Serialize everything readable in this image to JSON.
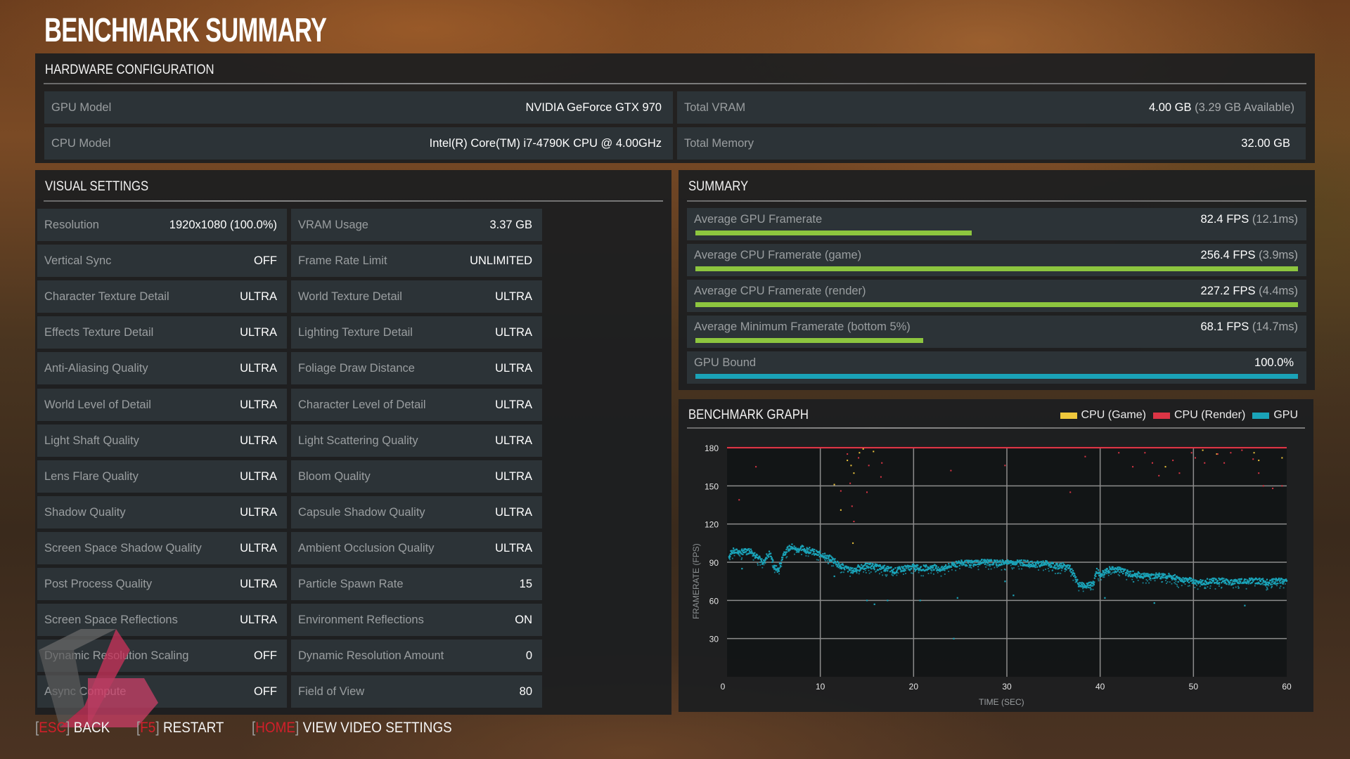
{
  "page": {
    "title": "BENCHMARK SUMMARY"
  },
  "hardware": {
    "title": "HARDWARE CONFIGURATION",
    "left": [
      {
        "label": "GPU Model",
        "value": "NVIDIA GeForce GTX 970",
        "sub": ""
      },
      {
        "label": "CPU Model",
        "value": "Intel(R) Core(TM) i7-4790K CPU @ 4.00GHz",
        "sub": ""
      }
    ],
    "right": [
      {
        "label": "Total VRAM",
        "value": "4.00 GB",
        "sub": "(3.29 GB Available)"
      },
      {
        "label": "Total Memory",
        "value": "32.00 GB",
        "sub": ""
      }
    ]
  },
  "visual_settings": {
    "title": "VISUAL SETTINGS",
    "left": [
      {
        "label": "Resolution",
        "value": "1920x1080 (100.0%)"
      },
      {
        "label": "Vertical Sync",
        "value": "OFF"
      },
      {
        "label": "Character Texture Detail",
        "value": "ULTRA"
      },
      {
        "label": "Effects Texture Detail",
        "value": "ULTRA"
      },
      {
        "label": "Anti-Aliasing Quality",
        "value": "ULTRA"
      },
      {
        "label": "World Level of Detail",
        "value": "ULTRA"
      },
      {
        "label": "Light Shaft Quality",
        "value": "ULTRA"
      },
      {
        "label": "Lens Flare Quality",
        "value": "ULTRA"
      },
      {
        "label": "Shadow Quality",
        "value": "ULTRA"
      },
      {
        "label": "Screen Space Shadow Quality",
        "value": "ULTRA"
      },
      {
        "label": "Post Process Quality",
        "value": "ULTRA"
      },
      {
        "label": "Screen Space Reflections",
        "value": "ULTRA"
      },
      {
        "label": "Dynamic Resolution Scaling",
        "value": "OFF"
      },
      {
        "label": "Async Compute",
        "value": "OFF"
      }
    ],
    "right": [
      {
        "label": "VRAM Usage",
        "value": "3.37 GB"
      },
      {
        "label": "Frame Rate Limit",
        "value": "UNLIMITED"
      },
      {
        "label": "World Texture Detail",
        "value": "ULTRA"
      },
      {
        "label": "Lighting Texture Detail",
        "value": "ULTRA"
      },
      {
        "label": "Foliage Draw Distance",
        "value": "ULTRA"
      },
      {
        "label": "Character Level of Detail",
        "value": "ULTRA"
      },
      {
        "label": "Light Scattering Quality",
        "value": "ULTRA"
      },
      {
        "label": "Bloom Quality",
        "value": "ULTRA"
      },
      {
        "label": "Capsule Shadow Quality",
        "value": "ULTRA"
      },
      {
        "label": "Ambient Occlusion Quality",
        "value": "ULTRA"
      },
      {
        "label": "Particle Spawn Rate",
        "value": "15"
      },
      {
        "label": "Environment Reflections",
        "value": "ON"
      },
      {
        "label": "Dynamic Resolution Amount",
        "value": "0"
      },
      {
        "label": "Field of View",
        "value": "80"
      }
    ]
  },
  "summary": {
    "title": "SUMMARY",
    "rows": [
      {
        "label": "Average GPU Framerate",
        "value": "82.4 FPS",
        "sub": "(12.1ms)",
        "fill": 0.458,
        "color": "#8dc63f"
      },
      {
        "label": "Average CPU Framerate (game)",
        "value": "256.4 FPS",
        "sub": "(3.9ms)",
        "fill": 1.0,
        "color": "#8dc63f"
      },
      {
        "label": "Average CPU Framerate (render)",
        "value": "227.2 FPS",
        "sub": "(4.4ms)",
        "fill": 1.0,
        "color": "#8dc63f"
      },
      {
        "label": "Average Minimum Framerate (bottom 5%)",
        "value": "68.1 FPS",
        "sub": "(14.7ms)",
        "fill": 0.378,
        "color": "#8dc63f"
      },
      {
        "label": "GPU Bound",
        "value": "100.0%",
        "sub": "",
        "fill": 1.0,
        "color": "#1aa3b8"
      }
    ]
  },
  "graph": {
    "title": "BENCHMARK GRAPH"
  },
  "chart_data": {
    "type": "scatter",
    "title": "BENCHMARK GRAPH",
    "xlabel": "TIME (SEC)",
    "ylabel": "FRAMERATE (FPS)",
    "xlim": [
      0,
      60
    ],
    "ylim": [
      0,
      180
    ],
    "x_ticks": [
      0,
      10,
      20,
      30,
      40,
      50,
      60
    ],
    "y_ticks": [
      30,
      60,
      90,
      120,
      150,
      180
    ],
    "grid": true,
    "legend_position": "top-right",
    "series": [
      {
        "name": "CPU (Game)",
        "color": "#f0c83c",
        "note": "mostly above 180 (clipped); sparse outliers shown",
        "points": [
          [
            12.9,
            170
          ],
          [
            13.3,
            166
          ],
          [
            13.6,
            160
          ],
          [
            14.2,
            176
          ],
          [
            14.6,
            179
          ],
          [
            15.7,
            177
          ],
          [
            11.5,
            151
          ],
          [
            12.2,
            131
          ],
          [
            13.5,
            105
          ],
          [
            47.0,
            165
          ],
          [
            51.0,
            178
          ],
          [
            52.5,
            175
          ],
          [
            56.5,
            176
          ],
          [
            57.0,
            170
          ],
          [
            59.5,
            172
          ]
        ]
      },
      {
        "name": "CPU (Render)",
        "color": "#dc3545",
        "note": "mostly clipped at 180",
        "clipped_value": 180,
        "points": [
          [
            1.3,
            139
          ],
          [
            3.1,
            165
          ],
          [
            12.2,
            146
          ],
          [
            12.9,
            175
          ],
          [
            13.2,
            152
          ],
          [
            13.4,
            134
          ],
          [
            13.6,
            122
          ],
          [
            14.1,
            172
          ],
          [
            15.0,
            145
          ],
          [
            15.2,
            166
          ],
          [
            16.6,
            168
          ],
          [
            16.5,
            157
          ],
          [
            24.0,
            162
          ],
          [
            29.8,
            166
          ],
          [
            36.8,
            145
          ],
          [
            38.4,
            173
          ],
          [
            42.0,
            176
          ],
          [
            43.5,
            165
          ],
          [
            44.8,
            176
          ],
          [
            45.6,
            168
          ],
          [
            46.3,
            158
          ],
          [
            47.8,
            170
          ],
          [
            48.5,
            160
          ],
          [
            49.8,
            176
          ],
          [
            50.2,
            172
          ],
          [
            51.2,
            168
          ],
          [
            52.6,
            175
          ],
          [
            53.3,
            168
          ],
          [
            54.0,
            176
          ],
          [
            55.2,
            178
          ],
          [
            56.4,
            171
          ],
          [
            57.0,
            160
          ],
          [
            57.5,
            150
          ],
          [
            58.5,
            148
          ],
          [
            59.5,
            150
          ]
        ]
      },
      {
        "name": "GPU",
        "color": "#1aa3b8",
        "x": [
          0.2,
          0.5,
          1,
          1.5,
          2,
          2.5,
          3,
          3.5,
          3.8,
          4.2,
          4.6,
          5,
          5.5,
          6,
          6.5,
          7,
          7.5,
          8,
          8.5,
          9,
          9.5,
          10,
          10.5,
          11,
          11.5,
          12,
          12.5,
          13,
          13.5,
          14,
          15,
          16,
          17,
          18,
          19,
          20,
          21,
          22,
          23,
          24,
          25,
          26,
          27,
          28,
          29,
          30,
          31,
          32,
          33,
          34,
          35,
          36,
          36.8,
          37.2,
          37.6,
          38,
          38.5,
          39,
          39.3,
          39.6,
          40,
          40.5,
          41,
          42,
          43,
          44,
          45,
          46,
          47,
          48,
          48.5,
          49,
          50,
          51,
          52,
          53,
          54,
          55,
          56,
          57,
          58,
          59,
          60
        ],
        "values": [
          95,
          100,
          99,
          99,
          99,
          100,
          96,
          93,
          91,
          95,
          98,
          88,
          84,
          97,
          101,
          103,
          100,
          102,
          100,
          100,
          98,
          97,
          96,
          94,
          92,
          88,
          87,
          85,
          84,
          86,
          88,
          87,
          86,
          84,
          86,
          87,
          86,
          87,
          85,
          88,
          90,
          90,
          91,
          91,
          90,
          91,
          91,
          90,
          89,
          90,
          88,
          88,
          86,
          80,
          74,
          73,
          72,
          73,
          75,
          84,
          81,
          83,
          85,
          85,
          82,
          81,
          80,
          80,
          80,
          79,
          76,
          77,
          76,
          75,
          76,
          76,
          75,
          76,
          76,
          76,
          75,
          76,
          76
        ]
      }
    ],
    "outliers_low": [
      [
        1.6,
        85
      ],
      [
        11.5,
        79
      ],
      [
        15.0,
        60
      ],
      [
        15.8,
        57
      ],
      [
        17.2,
        60
      ],
      [
        20.7,
        60
      ],
      [
        24.7,
        62
      ],
      [
        29.8,
        75
      ],
      [
        24.3,
        30
      ],
      [
        30.7,
        64
      ],
      [
        40.5,
        62
      ],
      [
        45.8,
        58
      ],
      [
        55.5,
        56
      ]
    ]
  },
  "footer": {
    "hints": [
      {
        "key": "ESC",
        "label": "BACK"
      },
      {
        "key": "F5",
        "label": "RESTART"
      },
      {
        "key": "HOME",
        "label": "VIEW VIDEO SETTINGS"
      }
    ]
  }
}
